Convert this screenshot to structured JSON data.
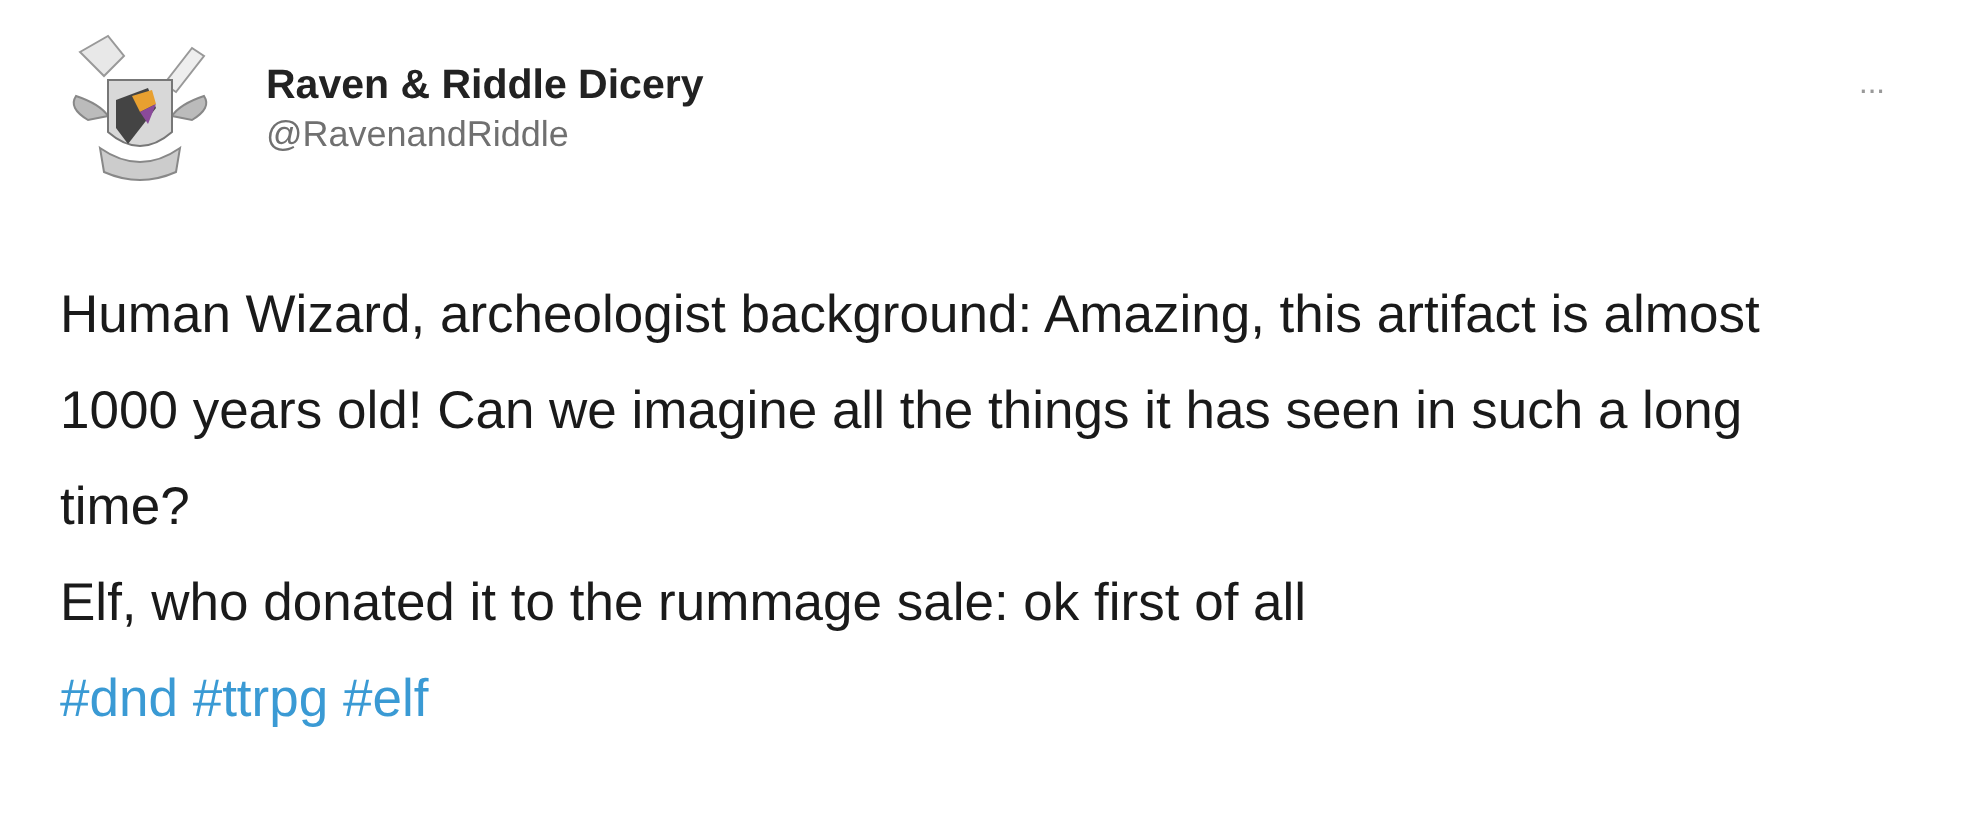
{
  "author": {
    "name": "Raven & Riddle Dicery",
    "handle": "@RavenandRiddle"
  },
  "more_menu": "···",
  "paragraphs": [
    "Human Wizard, archeologist background: Amazing, this artifact is almost 1000 years old! Can we imagine all the things it has seen in such a long time?",
    "Elf, who donated it to the rummage sale: ok first of all"
  ],
  "hashtags": [
    "#dnd",
    "#ttrpg",
    "#elf"
  ]
}
